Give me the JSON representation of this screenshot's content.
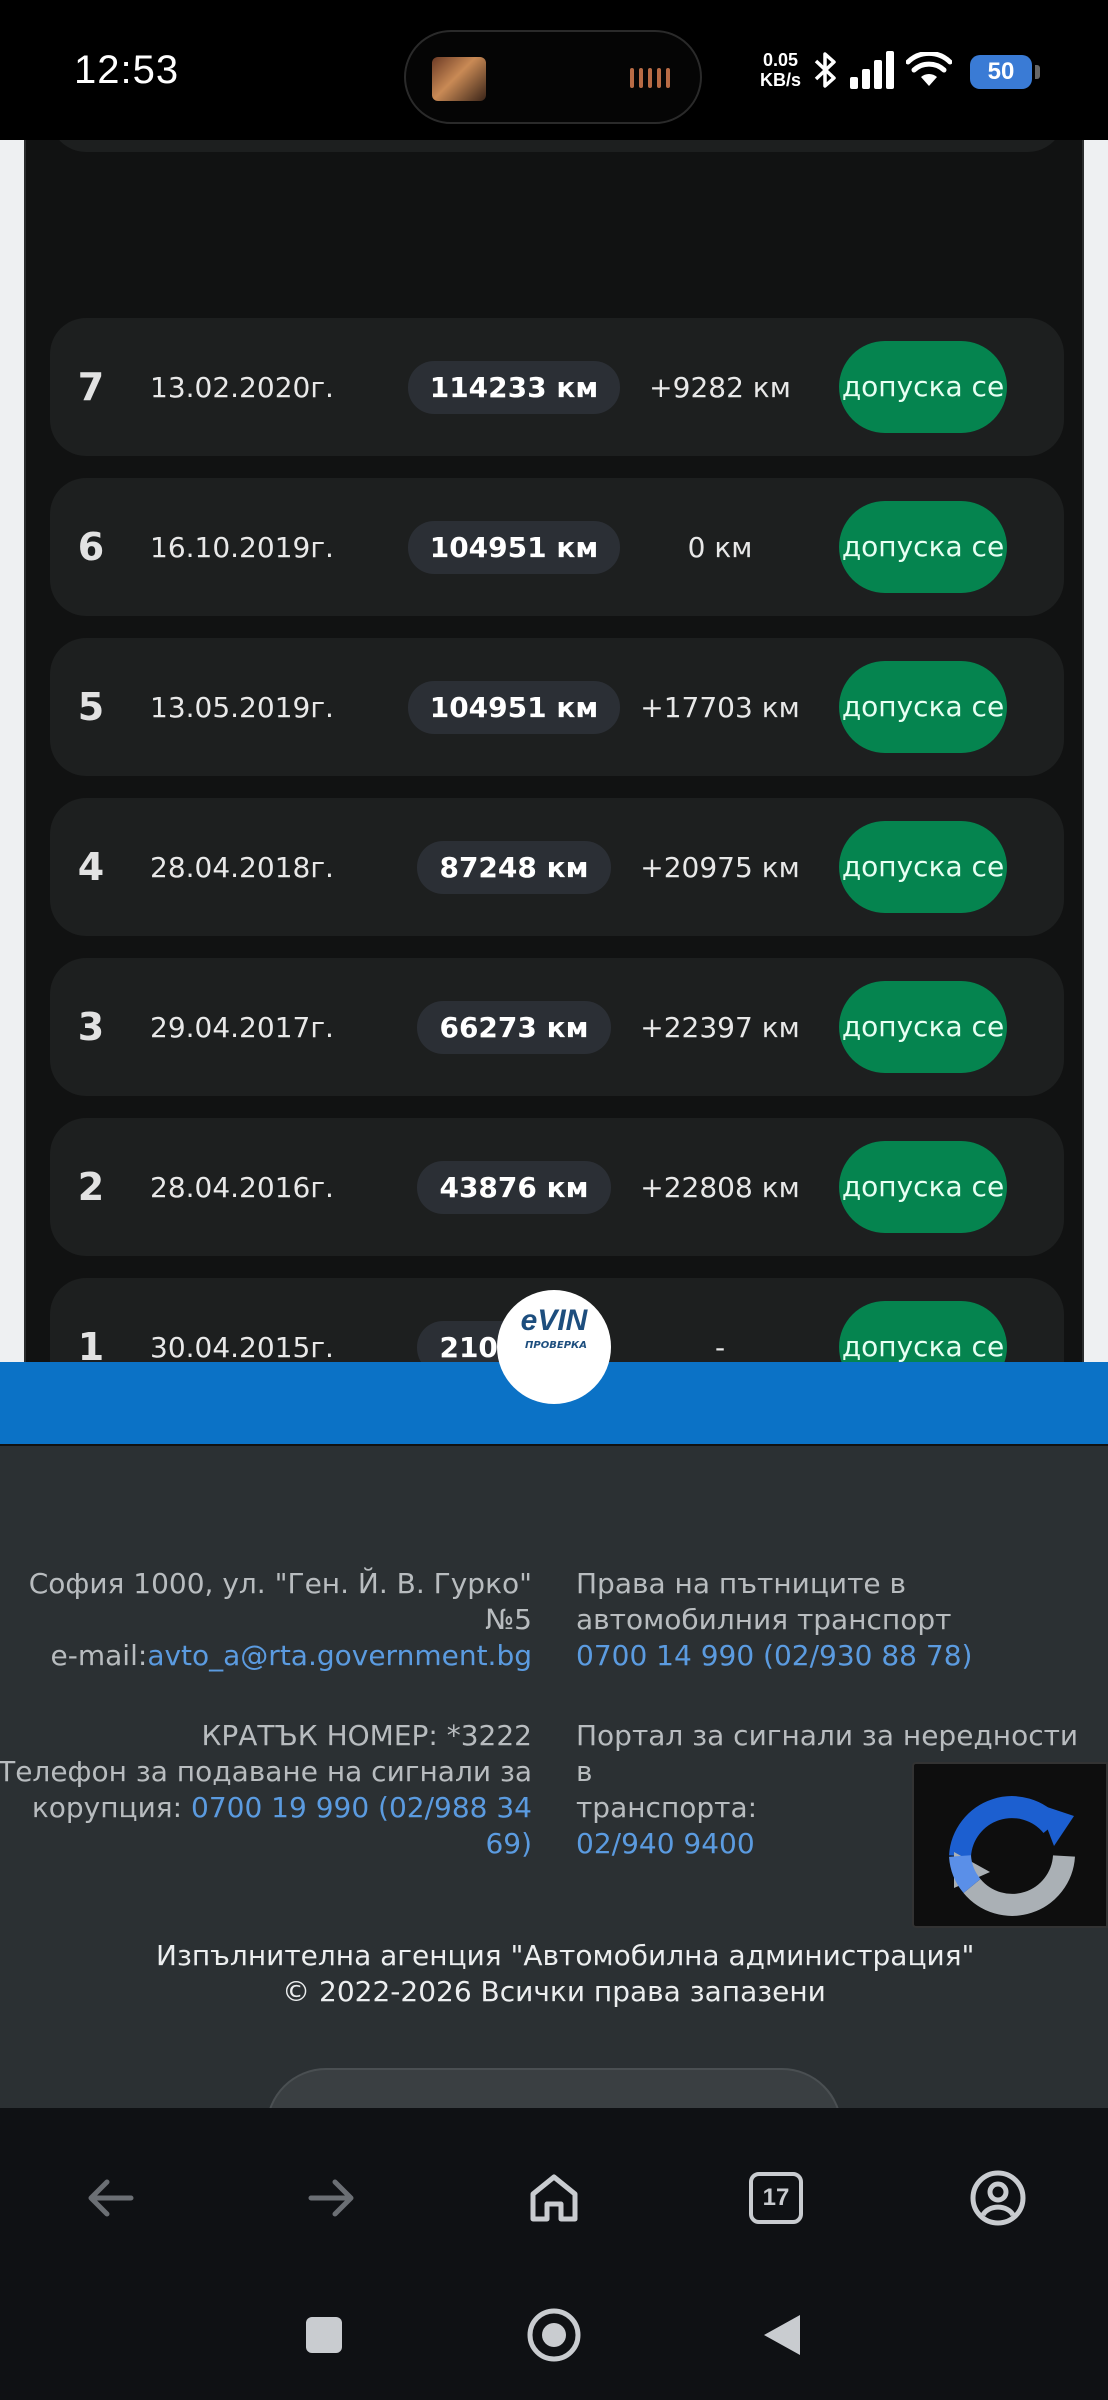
{
  "status_bar": {
    "time": "12:53",
    "net_speed_value": "0.05",
    "net_speed_unit": "KB/s",
    "battery": "50",
    "icons": [
      "bluetooth-icon",
      "signal-icon",
      "wifi-icon",
      "battery-icon"
    ]
  },
  "history": {
    "rows": [
      {
        "num": "7",
        "date": "13.02.2020г.",
        "km": "114233 км",
        "diff": "+9282 км",
        "status": "допуска се"
      },
      {
        "num": "6",
        "date": "16.10.2019г.",
        "km": "104951 км",
        "diff": "0 км",
        "status": "допуска се"
      },
      {
        "num": "5",
        "date": "13.05.2019г.",
        "km": "104951 км",
        "diff": "+17703 км",
        "status": "допуска се"
      },
      {
        "num": "4",
        "date": "28.04.2018г.",
        "km": "87248 км",
        "diff": "+20975 км",
        "status": "допуска се"
      },
      {
        "num": "3",
        "date": "29.04.2017г.",
        "km": "66273 км",
        "diff": "+22397 км",
        "status": "допуска се"
      },
      {
        "num": "2",
        "date": "28.04.2016г.",
        "km": "43876 км",
        "diff": "+22808 км",
        "status": "допуска се"
      },
      {
        "num": "1",
        "date": "30.04.2015г.",
        "km": "21068 км",
        "diff": "-",
        "status": "допуска се"
      }
    ],
    "status_color": "#05844f"
  },
  "logo": {
    "text": "eVIN",
    "sub": "ПРОВЕРКА"
  },
  "footer": {
    "address_line1": "София 1000, ул. \"Ген. Й. В. Гурко\"",
    "address_line2": "№5",
    "email_label": "e-mail:",
    "email": "avto_a@rta.government.bg",
    "short_number": "КРАТЪК НОМЕР: *3222",
    "corruption_line1": "Телефон за подаване на сигнали за",
    "corruption_label": "корупция: ",
    "corruption_phone_a": "0700 19 990 (02/988 34",
    "corruption_phone_b": "69)",
    "rights_line1": "Права на пътниците в",
    "rights_line2": "автомобилния транспорт",
    "rights_phone": "0700 14 990 (02/930 88 78)",
    "portal_line1": "Портал за сигнали за нередности в",
    "portal_line2": "транспорта:",
    "portal_phone": "02/940 9400",
    "agency": "Изпълнителна агенция \"Автомобилна администрация\"",
    "copyright": "© 2022-2026 Всички права запазени"
  },
  "browser_nav": {
    "tab_count": "17"
  },
  "colors": {
    "accent_blue": "#0b72c6",
    "link": "#5b9be0"
  }
}
